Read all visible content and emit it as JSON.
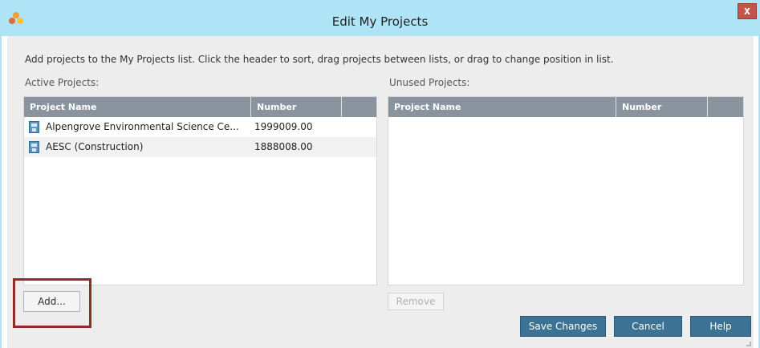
{
  "window": {
    "title": "Edit My Projects",
    "close_label": "x",
    "app_icon": "app-logo-icon"
  },
  "instructions": "Add projects to the My Projects list. Click the header to sort, drag projects between lists, or drag to change position in list.",
  "active": {
    "label": "Active Projects:",
    "columns": [
      "Project Name",
      "Number",
      ""
    ],
    "rows": [
      {
        "icon": "project-icon",
        "name": "Alpengrove Environmental Science Ce...",
        "number": "1999009.00"
      },
      {
        "icon": "project-icon",
        "name": "AESC (Construction)",
        "number": "1888008.00"
      }
    ],
    "add_label": "Add..."
  },
  "unused": {
    "label": "Unused Projects:",
    "columns": [
      "Project Name",
      "Number",
      ""
    ],
    "rows": [],
    "remove_label": "Remove"
  },
  "footer": {
    "save_label": "Save Changes",
    "cancel_label": "Cancel",
    "help_label": "Help"
  },
  "colors": {
    "titlebar": "#aee4f6",
    "grid_header": "#8a949e",
    "primary_button": "#3c7294",
    "highlight": "#8b2f2a",
    "close_button": "#c4544a"
  }
}
